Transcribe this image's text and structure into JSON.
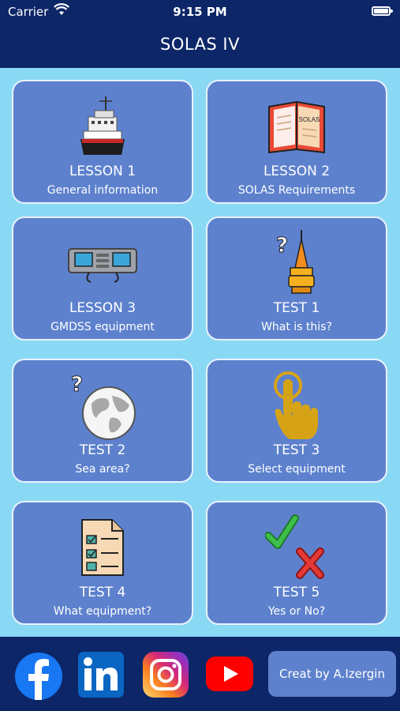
{
  "status_bar": {
    "carrier": "Carrier",
    "time": "9:15 PM"
  },
  "header": {
    "title": "SOLAS IV"
  },
  "tiles": [
    {
      "title": "LESSON 1",
      "subtitle": "General information",
      "icon": "ship-icon"
    },
    {
      "title": "LESSON 2",
      "subtitle": "SOLAS Requirements",
      "icon": "book-icon",
      "book_label": "SOLAS"
    },
    {
      "title": "LESSON 3",
      "subtitle": "GMDSS equipment",
      "icon": "radio-equipment-icon"
    },
    {
      "title": "TEST 1",
      "subtitle": "What is this?",
      "icon": "beacon-question-icon"
    },
    {
      "title": "TEST 2",
      "subtitle": "Sea area?",
      "icon": "globe-question-icon"
    },
    {
      "title": "TEST 3",
      "subtitle": "Select equipment",
      "icon": "pointing-hand-icon"
    },
    {
      "title": "TEST 4",
      "subtitle": "What equipment?",
      "icon": "checklist-icon"
    },
    {
      "title": "TEST 5",
      "subtitle": "Yes or No?",
      "icon": "check-cross-icon"
    }
  ],
  "footer": {
    "social": [
      "facebook-icon",
      "linkedin-icon",
      "instagram-icon",
      "youtube-icon"
    ],
    "credit": "Creat by A.Izergin"
  },
  "colors": {
    "bar": "#0c2668",
    "background": "#8ad9f4",
    "tile": "#5d81cd",
    "facebook": "#1877f2",
    "linkedin": "#0a66c2",
    "youtube": "#ff0000"
  }
}
